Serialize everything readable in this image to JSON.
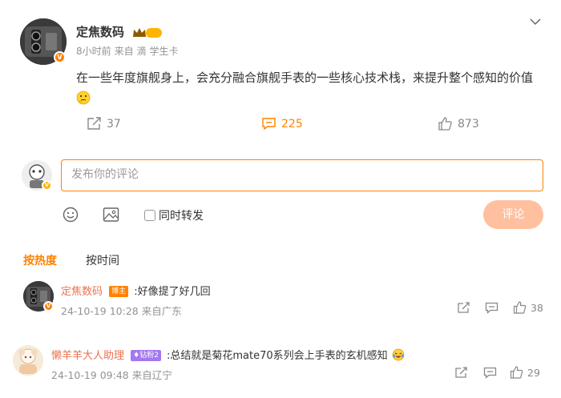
{
  "post": {
    "author": "定焦数码",
    "level_badge": "II",
    "time": "8小时前",
    "source_prefix": "来自",
    "source": "滴 学生卡",
    "text": "在一些年度旗舰身上，会充分融合旗舰手表的一些核心技术栈，来提升整个感知的价值",
    "emoji": "thinking-face-icon",
    "actions": {
      "repost_count": "37",
      "comment_count": "225",
      "like_count": "873"
    }
  },
  "comment_box": {
    "placeholder": "发布你的评论",
    "repost_label": "同时转发",
    "submit_label": "评论"
  },
  "sort": {
    "hot_label": "按热度",
    "time_label": "按时间"
  },
  "comments": [
    {
      "name": "定焦数码",
      "tag": "博主",
      "text": ":好像提了好几回",
      "datetime": "24-10-19 10:28",
      "location": "来自广东",
      "like_count": "38"
    },
    {
      "name": "懒羊羊大人助理",
      "tag": "钻粉2",
      "text": ":总结就是菊花mate70系列会上手表的玄机感知",
      "datetime": "24-10-19 09:48",
      "location": "来自辽宁",
      "like_count": "29"
    }
  ],
  "colors": {
    "accent": "#ff8200",
    "name_link": "#eb7350",
    "submit_disabled": "#ffc09f"
  }
}
